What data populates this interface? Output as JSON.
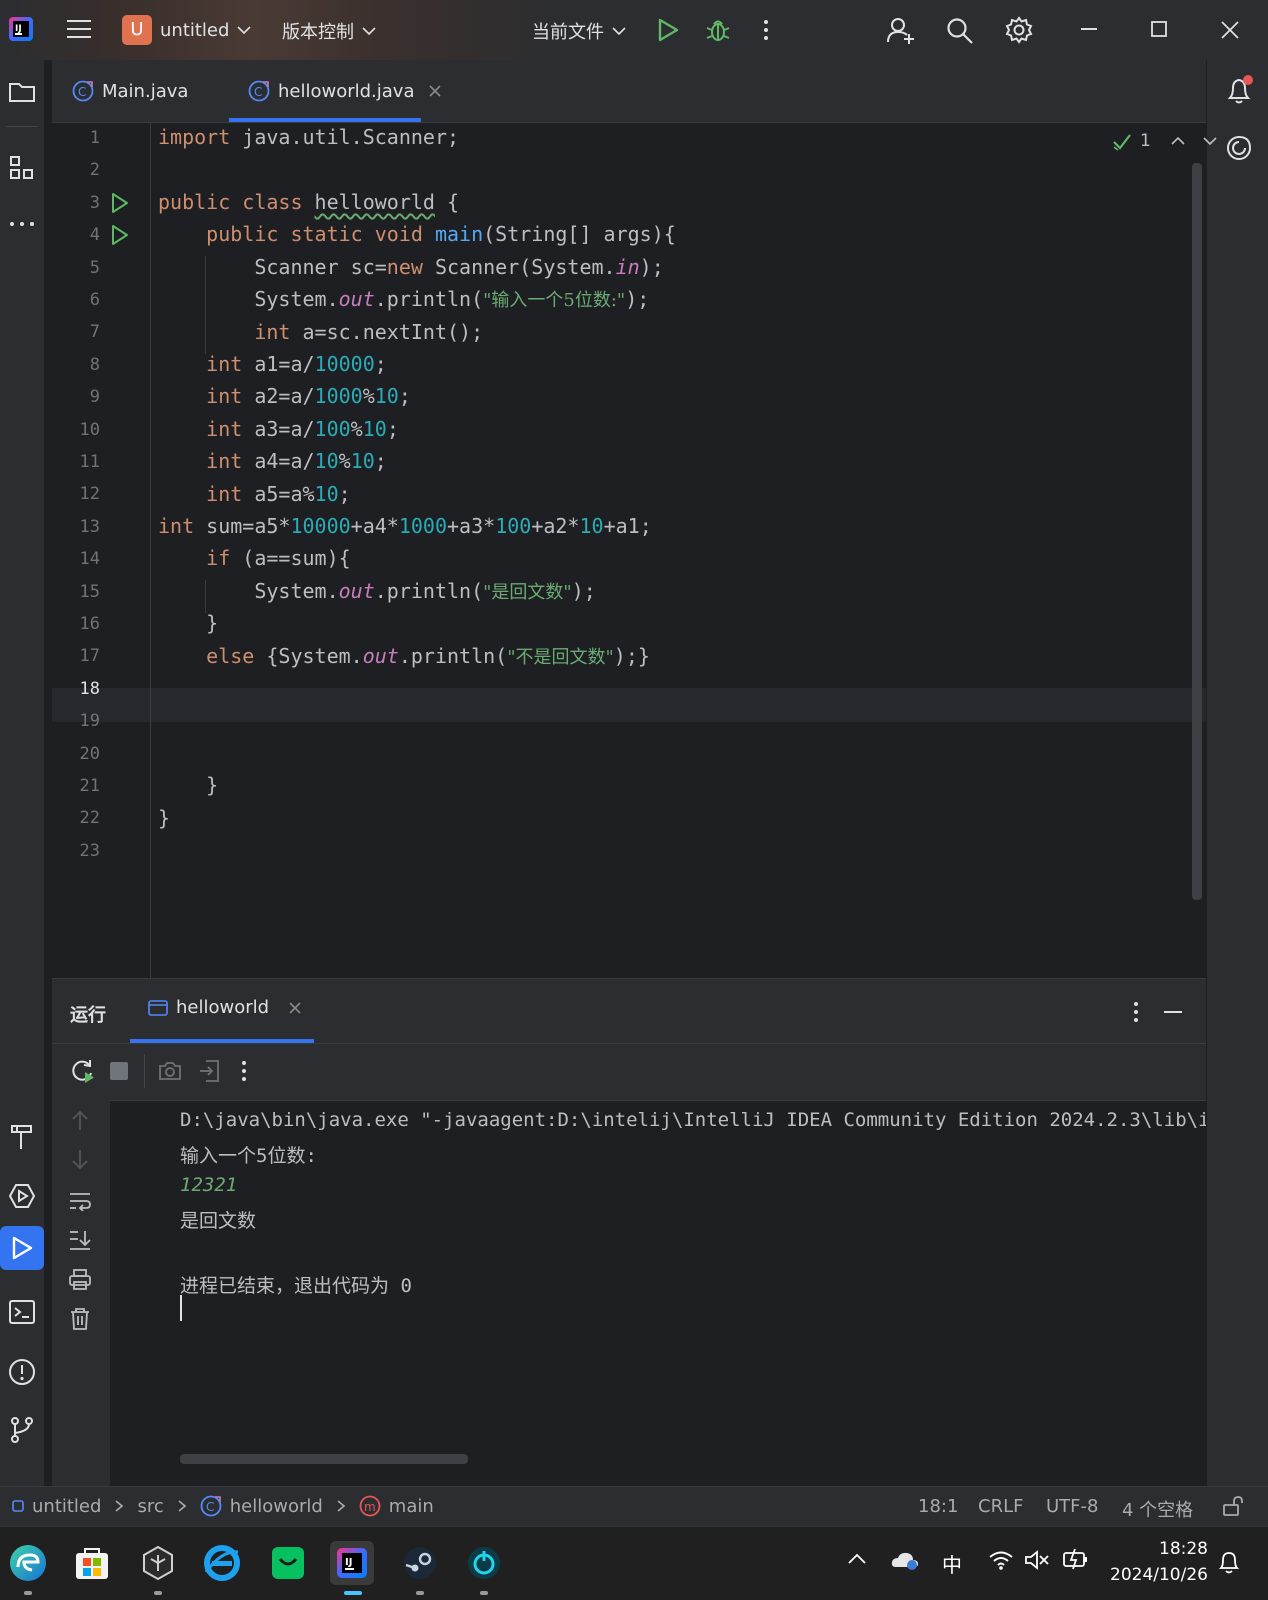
{
  "titlebar": {
    "project_badge": "U",
    "project_name": "untitled",
    "vcs_menu": "版本控制",
    "run_config": "当前文件"
  },
  "editor_tabs": [
    {
      "label": "Main.java",
      "active": false
    },
    {
      "label": "helloworld.java",
      "active": true
    }
  ],
  "inspection": {
    "count": "1"
  },
  "code": {
    "line_numbers": [
      "1",
      "2",
      "3",
      "4",
      "5",
      "6",
      "7",
      "8",
      "9",
      "10",
      "11",
      "12",
      "13",
      "14",
      "15",
      "16",
      "17",
      "18",
      "19",
      "20",
      "21",
      "22",
      "23"
    ],
    "current_line": "18",
    "strings": {
      "prompt": "\"输入一个5位数:\"",
      "yes": "\"是回文数\"",
      "no": "\"不是回文数\""
    }
  },
  "run_panel": {
    "title": "运行",
    "tab_label": "helloworld",
    "output": {
      "command": "D:\\java\\bin\\java.exe \"-javaagent:D:\\intelij\\IntelliJ IDEA Community Edition 2024.2.3\\lib\\i",
      "prompt": "输入一个5位数:",
      "input": "12321",
      "result": "是回文数",
      "exit": "进程已结束，退出代码为 0"
    }
  },
  "statusbar": {
    "breadcrumb": [
      "untitled",
      "src",
      "helloworld",
      "main"
    ],
    "position": "18:1",
    "line_ending": "CRLF",
    "encoding": "UTF-8",
    "indent": "4 个空格"
  },
  "taskbar": {
    "ime": "中",
    "time": "18:28",
    "date": "2024/10/26"
  },
  "colors": {
    "accent": "#3574f0",
    "keyword": "#cf8e6d",
    "number": "#2aacb8",
    "string": "#6aab73",
    "run_green": "#5fb865"
  }
}
